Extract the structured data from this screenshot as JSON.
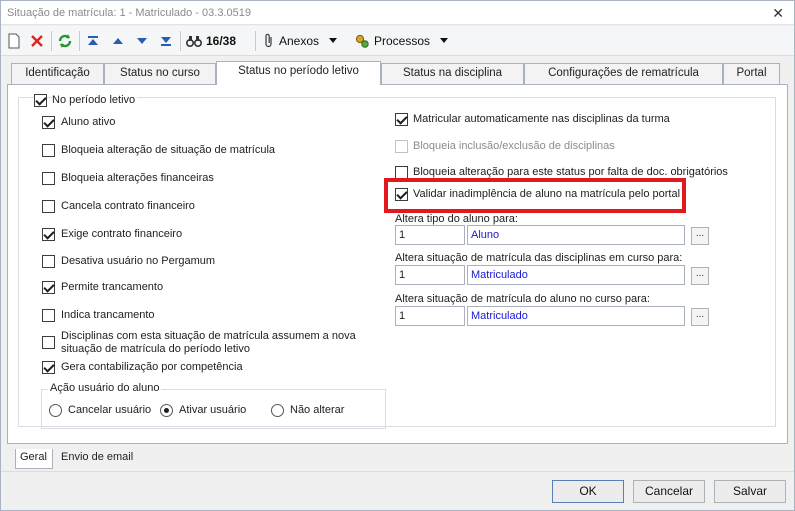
{
  "window": {
    "title": "Situação de matrícula: 1 - Matriculado - 03.3.0519",
    "close_label": "✕"
  },
  "toolbar": {
    "record_counter": "16/38",
    "anexos_label": "Anexos",
    "processos_label": "Processos"
  },
  "tabs": [
    {
      "label": "Identificação"
    },
    {
      "label": "Status no curso"
    },
    {
      "label": "Status no período letivo"
    },
    {
      "label": "Status na disciplina"
    },
    {
      "label": "Configurações de rematrícula"
    },
    {
      "label": "Portal"
    }
  ],
  "section": {
    "title": "No período letivo",
    "checked": true
  },
  "left_checks": [
    {
      "label": "Aluno ativo",
      "checked": true
    },
    {
      "label": "Bloqueia alteração de situação de matrícula",
      "checked": false
    },
    {
      "label": "Bloqueia alterações financeiras",
      "checked": false
    },
    {
      "label": "Cancela contrato financeiro",
      "checked": false
    },
    {
      "label": "Exige contrato financeiro",
      "checked": true
    },
    {
      "label": "Desativa usuário no Pergamum",
      "checked": false
    },
    {
      "label": "Permite trancamento",
      "checked": true
    },
    {
      "label": "Indica trancamento",
      "checked": false
    },
    {
      "label": "Disciplinas com esta situação de matrícula assumem a nova situação de matrícula do período letivo",
      "checked": false
    },
    {
      "label": "Gera contabilização por competência",
      "checked": true
    }
  ],
  "right_checks": [
    {
      "label": "Matricular automaticamente nas disciplinas da turma",
      "checked": true,
      "disabled": false
    },
    {
      "label": "Bloqueia inclusão/exclusão de disciplinas",
      "checked": false,
      "disabled": true
    },
    {
      "label": "Bloqueia alteração para este status por falta de doc. obrigatórios",
      "checked": false,
      "disabled": false
    },
    {
      "label": "Validar inadimplência de aluno na matrícula pelo portal",
      "checked": true,
      "disabled": false
    }
  ],
  "fields": [
    {
      "label": "Altera tipo do aluno para:",
      "code": "1",
      "value": "Aluno"
    },
    {
      "label": "Altera situação de matrícula das disciplinas em curso para:",
      "code": "1",
      "value": "Matriculado"
    },
    {
      "label": "Altera situação de matrícula do aluno no curso para:",
      "code": "1",
      "value": "Matriculado"
    }
  ],
  "browse_label": "...",
  "acao": {
    "title": "Ação usuário do aluno",
    "options": [
      {
        "label": "Cancelar usuário",
        "selected": false
      },
      {
        "label": "Ativar usuário",
        "selected": true
      },
      {
        "label": "Não alterar",
        "selected": false
      }
    ]
  },
  "bottom_tabs": [
    {
      "label": "Geral"
    },
    {
      "label": "Envio de email"
    }
  ],
  "buttons": {
    "ok": "OK",
    "cancel": "Cancelar",
    "save": "Salvar"
  },
  "colors": {
    "highlight": "#e3171e",
    "link_value": "#1a1ad0"
  }
}
